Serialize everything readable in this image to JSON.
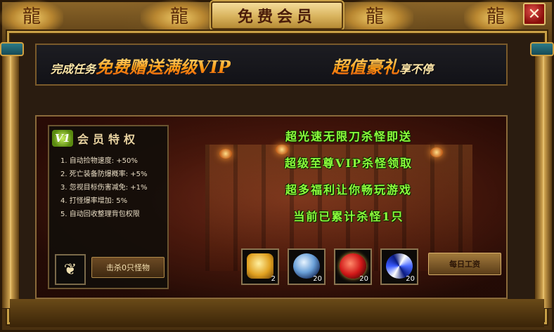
{
  "window": {
    "title": "免费会员",
    "close_icon": "close-icon"
  },
  "banner": {
    "left_small_1": "完成任务",
    "left_big": "免费赠送满级VIP",
    "right_big": "超值豪礼",
    "right_small": "享不停"
  },
  "privileges": {
    "badge": "V1",
    "title": "会员特权",
    "items": [
      "1. 自动捡物速度: +50%",
      "2. 死亡装备防爆概率: +5%",
      "3. 忽视目标伤害减免: +1%",
      "4. 打怪爆率增加: 5%",
      "5. 自动回收整理背包权限"
    ],
    "wing_icon": "wings-icon",
    "kill_button": "击杀0只怪物"
  },
  "slogans": [
    "超光速无限刀杀怪即送",
    "超级至尊VIP杀怪领取",
    "超多福利让你畅玩游戏",
    "当前已累计杀怪1只"
  ],
  "rewards": [
    {
      "icon": "gold-ingot-icon",
      "count": "2"
    },
    {
      "icon": "blue-orb-icon",
      "count": "20"
    },
    {
      "icon": "red-gem-icon",
      "count": "20"
    },
    {
      "icon": "swirl-orb-icon",
      "count": "20"
    }
  ],
  "daily_button": "每日工资",
  "colors": {
    "slogan_green": "#8cff3c",
    "banner_orange": "#ffae2a",
    "frame_gold": "#c9a046"
  }
}
